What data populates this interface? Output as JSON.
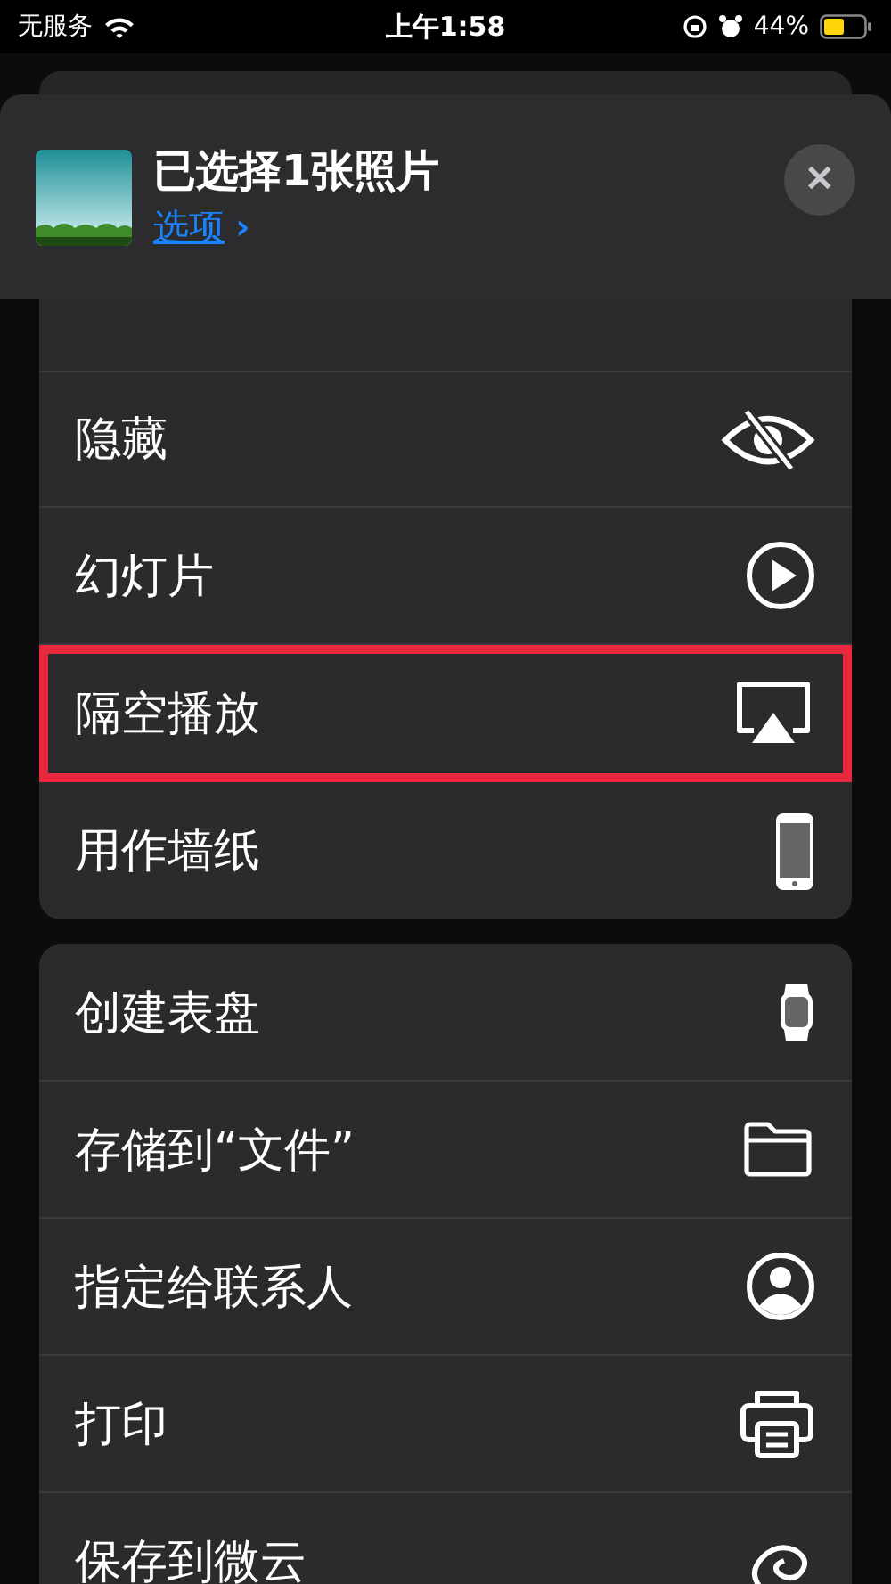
{
  "status_bar": {
    "carrier": "无服务",
    "time": "上午1:58",
    "battery": "44%"
  },
  "header": {
    "title": "已选择1张照片",
    "options_link": "选项",
    "options_arrow": "›",
    "close": "✕"
  },
  "groups": [
    {
      "items": [
        {
          "label": "隐藏",
          "kind": "hide",
          "highlighted": false
        },
        {
          "label": "幻灯片",
          "kind": "slideshow",
          "highlighted": false
        },
        {
          "label": "隔空播放",
          "kind": "airplay",
          "highlighted": true
        },
        {
          "label": "用作墙纸",
          "kind": "wallpaper",
          "highlighted": false
        }
      ]
    },
    {
      "items": [
        {
          "label": "创建表盘",
          "kind": "watch",
          "highlighted": false
        },
        {
          "label": "存储到“文件”",
          "kind": "folder",
          "highlighted": false
        },
        {
          "label": "指定给联系人",
          "kind": "contact",
          "highlighted": false
        },
        {
          "label": "打印",
          "kind": "print",
          "highlighted": false
        },
        {
          "label": "保存到微云",
          "kind": "cloud",
          "highlighted": false
        }
      ]
    }
  ]
}
